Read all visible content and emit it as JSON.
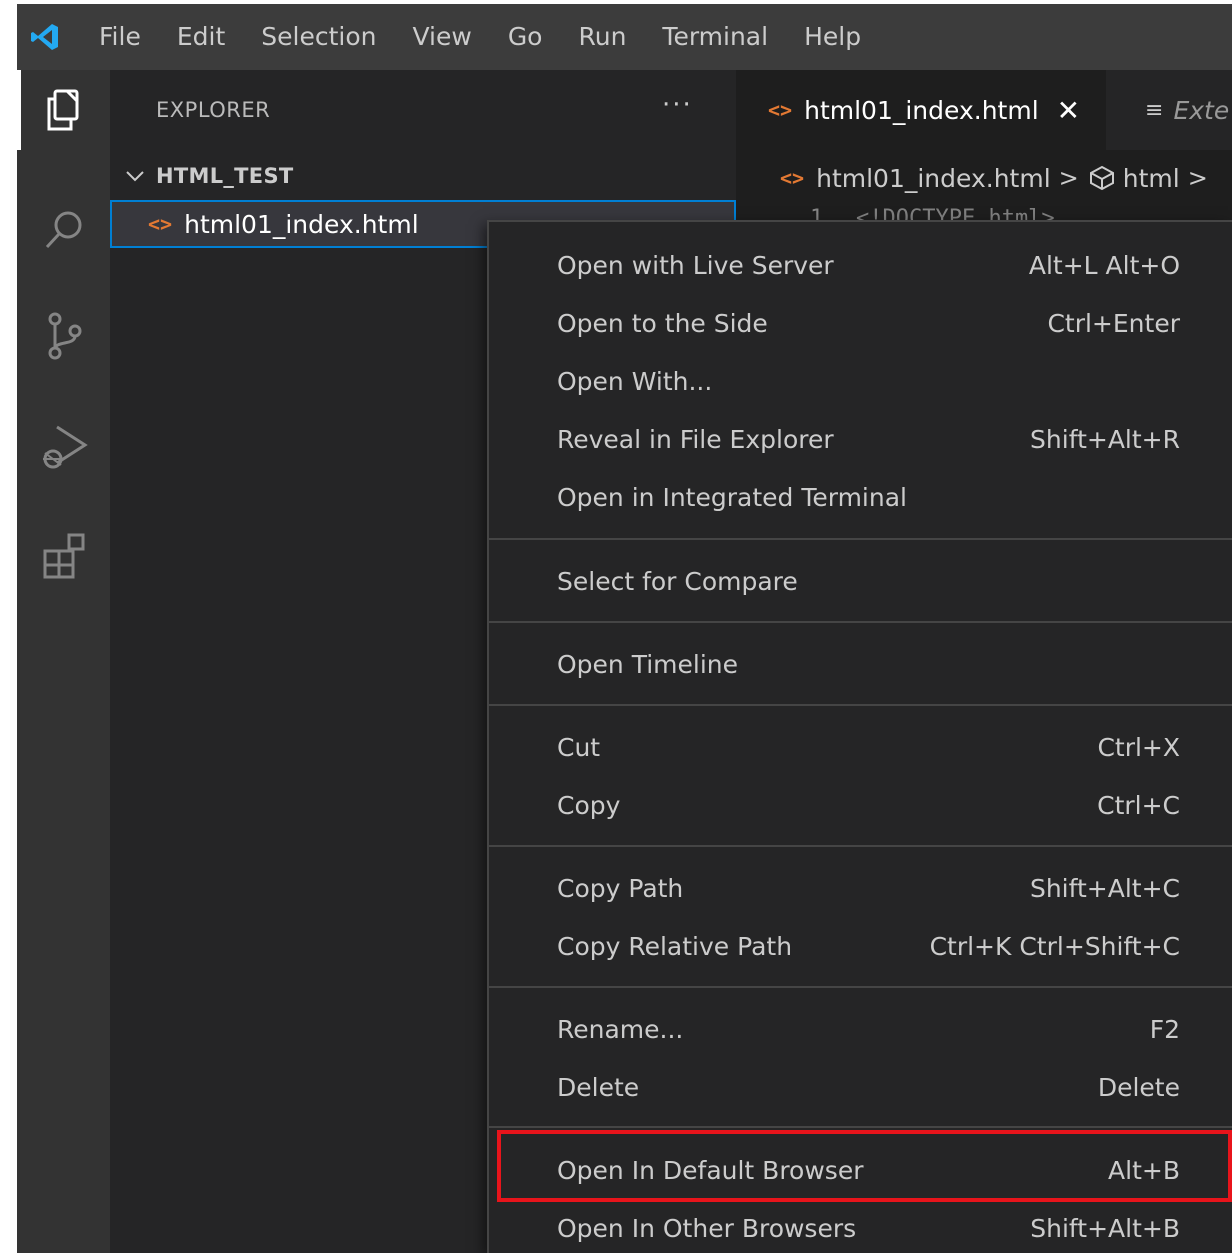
{
  "menubar": {
    "logo": "vscode-logo",
    "items": [
      "File",
      "Edit",
      "Selection",
      "View",
      "Go",
      "Run",
      "Terminal",
      "Help"
    ]
  },
  "activity_bar": {
    "icons": [
      "explorer-icon",
      "search-icon",
      "source-control-icon",
      "run-debug-icon",
      "extensions-icon"
    ]
  },
  "sidebar": {
    "title": "EXPLORER",
    "more": "···",
    "folder": "HTML_TEST",
    "file_icon": "<>",
    "file": "html01_index.html"
  },
  "editor": {
    "tab_icon": "<>",
    "active_tab": "html01_index.html",
    "close": "✕",
    "second_tab_icon": "≡",
    "second_tab": "Exte",
    "breadcrumb_icon": "<>",
    "breadcrumb_file": "html01_index.html",
    "breadcrumb_sep": ">",
    "breadcrumb_node": "html",
    "line_number": "1",
    "line_code": "<!DOCTYPE html>"
  },
  "context_menu": {
    "groups": [
      [
        {
          "label": "Open with Live Server",
          "shortcut": "Alt+L Alt+O"
        },
        {
          "label": "Open to the Side",
          "shortcut": "Ctrl+Enter"
        },
        {
          "label": "Open With...",
          "shortcut": ""
        },
        {
          "label": "Reveal in File Explorer",
          "shortcut": "Shift+Alt+R"
        },
        {
          "label": "Open in Integrated Terminal",
          "shortcut": ""
        }
      ],
      [
        {
          "label": "Select for Compare",
          "shortcut": ""
        }
      ],
      [
        {
          "label": "Open Timeline",
          "shortcut": ""
        }
      ],
      [
        {
          "label": "Cut",
          "shortcut": "Ctrl+X"
        },
        {
          "label": "Copy",
          "shortcut": "Ctrl+C"
        }
      ],
      [
        {
          "label": "Copy Path",
          "shortcut": "Shift+Alt+C"
        },
        {
          "label": "Copy Relative Path",
          "shortcut": "Ctrl+K Ctrl+Shift+C"
        }
      ],
      [
        {
          "label": "Rename...",
          "shortcut": "F2"
        },
        {
          "label": "Delete",
          "shortcut": "Delete"
        }
      ],
      [
        {
          "label": "Open In Default Browser",
          "shortcut": "Alt+B"
        },
        {
          "label": "Open In Other Browsers",
          "shortcut": "Shift+Alt+B"
        }
      ]
    ]
  },
  "colors": {
    "accent": "#007fd4",
    "highlight": "#e8141b",
    "html_icon": "#e37933"
  }
}
